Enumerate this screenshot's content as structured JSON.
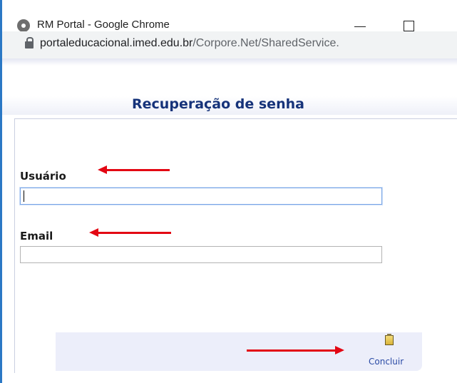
{
  "window": {
    "title": "RM Portal - Google Chrome",
    "minimize_glyph": "—",
    "maximize_glyph": "☐"
  },
  "address_bar": {
    "url_host": "portaleducacional.imed.edu.br",
    "url_path": "/Corpore.Net/SharedService."
  },
  "page": {
    "heading": "Recuperação de senha",
    "fields": {
      "usuario_label": "Usuário",
      "usuario_value": "",
      "email_label": "Email",
      "email_value": ""
    },
    "actions": {
      "concluir_label": "Concluir"
    }
  },
  "colors": {
    "heading": "#16337a",
    "annotation_arrow": "#e30613",
    "link": "#2a4aa5"
  },
  "icons": [
    "chrome-icon",
    "lock-icon",
    "concluir-icon"
  ]
}
